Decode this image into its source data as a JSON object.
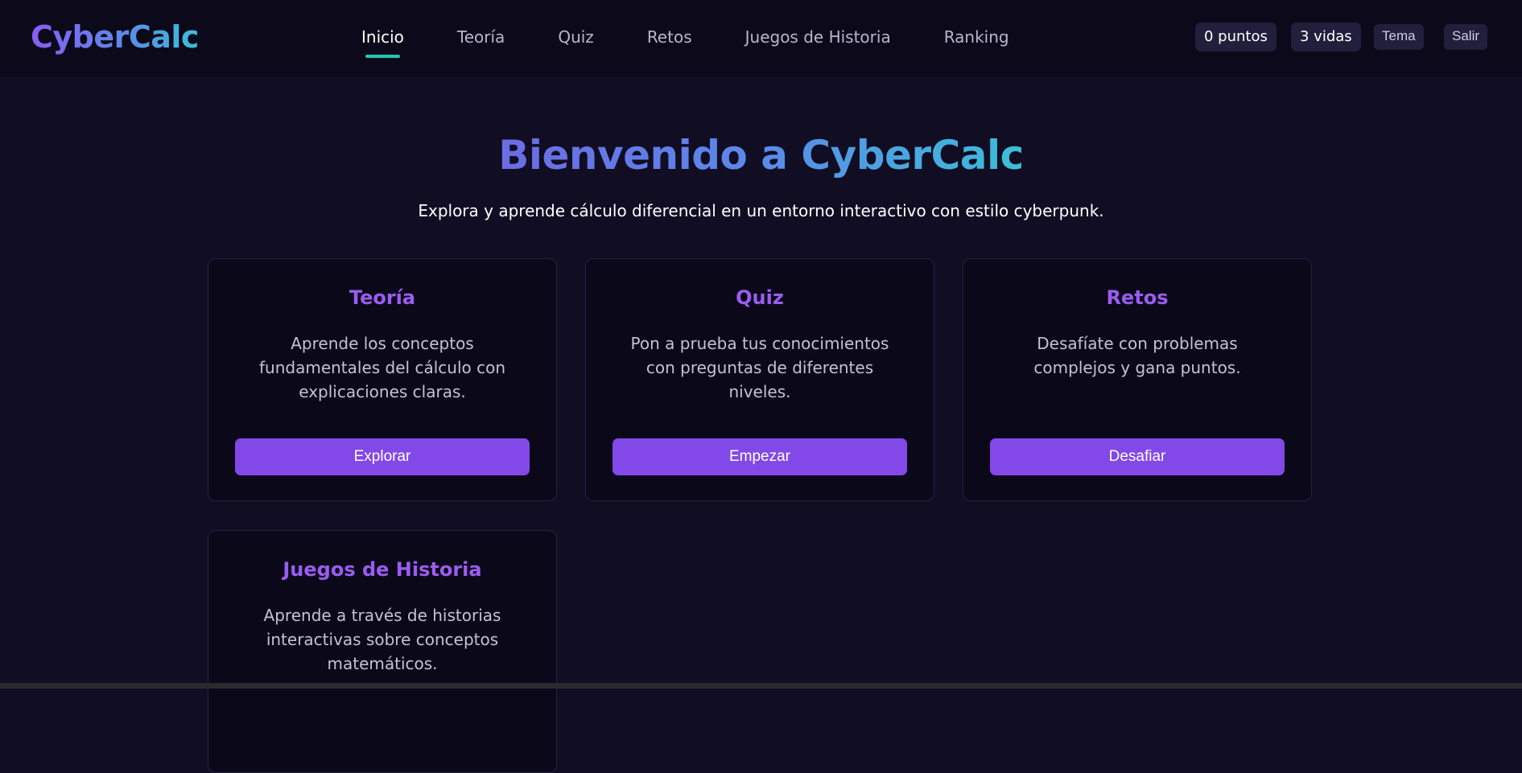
{
  "brand": {
    "logo": "CyberCalc"
  },
  "nav": {
    "items": [
      {
        "label": "Inicio",
        "active": true
      },
      {
        "label": "Teoría",
        "active": false
      },
      {
        "label": "Quiz",
        "active": false
      },
      {
        "label": "Retos",
        "active": false
      },
      {
        "label": "Juegos de Historia",
        "active": false
      },
      {
        "label": "Ranking",
        "active": false
      }
    ]
  },
  "user": {
    "points": "0 puntos",
    "lives": "3 vidas",
    "theme_label": "Tema",
    "logout_label": "Salir"
  },
  "hero": {
    "title": "Bienvenido a CyberCalc",
    "subtitle": "Explora y aprende cálculo diferencial en un entorno interactivo con estilo cyberpunk."
  },
  "cards": [
    {
      "title": "Teoría",
      "description": "Aprende los conceptos fundamentales del cálculo con explicaciones claras.",
      "button": "Explorar"
    },
    {
      "title": "Quiz",
      "description": "Pon a prueba tus conocimientos con preguntas de diferentes niveles.",
      "button": "Empezar"
    },
    {
      "title": "Retos",
      "description": "Desafíate con problemas complejos y gana puntos.",
      "button": "Desafiar"
    },
    {
      "title": "Juegos de Historia",
      "description": "Aprende a través de historias interactivas sobre conceptos matemáticos."
    }
  ],
  "colors": {
    "background": "#110e24",
    "header": "#0c0a1a",
    "accent_purple": "#8348e8",
    "card_title": "#9b5cf2",
    "active_underline": "#21c7b4"
  }
}
